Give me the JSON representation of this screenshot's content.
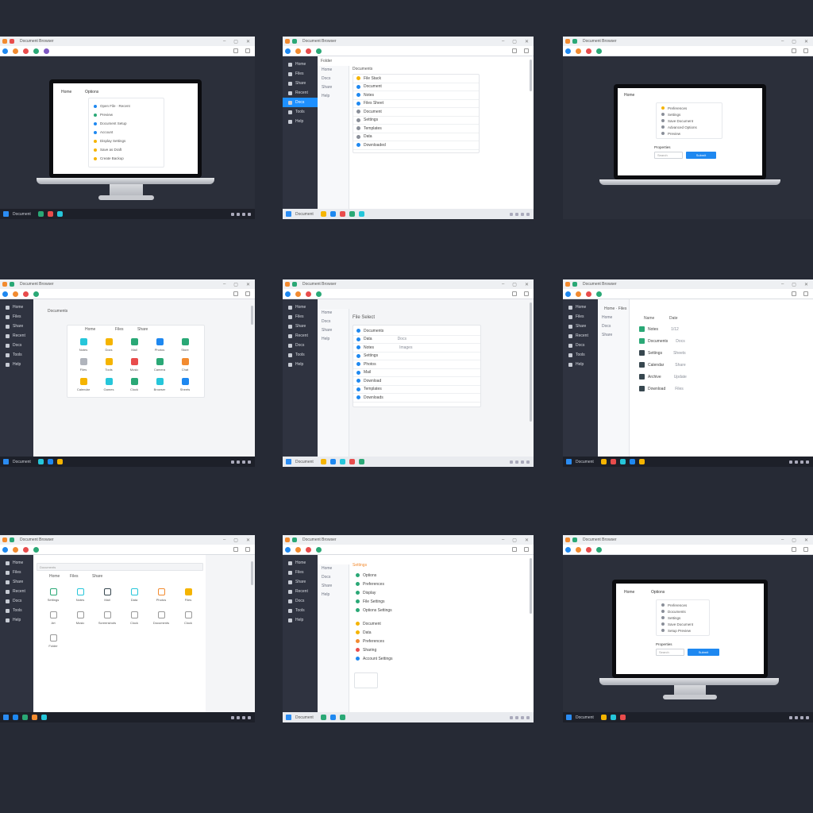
{
  "browser": {
    "title": "Document Browser",
    "minimize": "–",
    "maximize": "▢",
    "close": "✕"
  },
  "taskbar": {
    "label": "Document"
  },
  "sidebar": [
    "Home",
    "Files",
    "Share",
    "Recent",
    "Docs",
    "Tools",
    "Help"
  ],
  "subnav": [
    "Home",
    "Docs",
    "Share",
    "Help"
  ],
  "tile1": {
    "tabs": [
      "Home",
      "Options"
    ],
    "options": [
      "Open File · Recent",
      "Preview",
      "Document Setup",
      "Account",
      "Display Settings",
      "Save as Draft",
      "Create Backup"
    ]
  },
  "tile2": {
    "header": "Folder",
    "crumb": "Documents",
    "rows": [
      "File Stack",
      "Document",
      "Notes",
      "Files Sheet",
      "Document",
      "Settings",
      "Templates",
      "Data",
      "Downloaded"
    ]
  },
  "tile3": {
    "header": "Home",
    "options": [
      "Preferences",
      "Settings",
      "Save Document",
      "Advanced Options",
      "Preview"
    ],
    "section": "Properties",
    "field": "Search",
    "button": "Submit"
  },
  "tile4": {
    "crumb": "Documents",
    "headers": [
      "Home",
      "Files",
      "Share"
    ],
    "apps": [
      "Notes",
      "Docs",
      "Mail",
      "Photos",
      "Store",
      "Files",
      "Tools",
      "Music",
      "Camera",
      "Chat",
      "Calendar",
      "Games",
      "Clock",
      "Browser",
      "Sheets"
    ]
  },
  "tile5": {
    "header": "File Select",
    "rows": [
      "Documents",
      "Data",
      "Notes",
      "Settings",
      "Photos",
      "Mail",
      "Download",
      "Templates",
      "Downloads"
    ],
    "values": [
      "",
      "Docs",
      "Images"
    ]
  },
  "tile6": {
    "crumb": "Home · Files",
    "headers": [
      "Name",
      "Date"
    ],
    "rows": [
      "Notes",
      "Documents",
      "Settings",
      "Calendar",
      "Archive",
      "Download"
    ],
    "dates": [
      "1/12",
      "Docs",
      "Sheets",
      "Share",
      "Update",
      "Files"
    ]
  },
  "tile7": {
    "crumb": "Documents",
    "headers": [
      "Home",
      "Files",
      "Share"
    ],
    "apps": [
      "Settings",
      "Notes",
      "Mail",
      "Data",
      "Photos",
      "Files",
      "Art",
      "Music",
      "Screenshots",
      "Clock",
      "Documents",
      "Clock",
      "Folder"
    ]
  },
  "tile8": {
    "crumb": "Settings",
    "rows": [
      "Options",
      "Preferences",
      "Display",
      "File Settings",
      "Options Settings",
      "Document",
      "Data",
      "Preferences",
      "Sharing",
      "Account Settings"
    ]
  },
  "tile9": {
    "tabs": [
      "Home",
      "Options"
    ],
    "options": [
      "Preferences",
      "Documents",
      "Settings",
      "Save Document",
      "Setup Preview"
    ],
    "section": "Properties",
    "field": "Search",
    "button": "Submit"
  }
}
